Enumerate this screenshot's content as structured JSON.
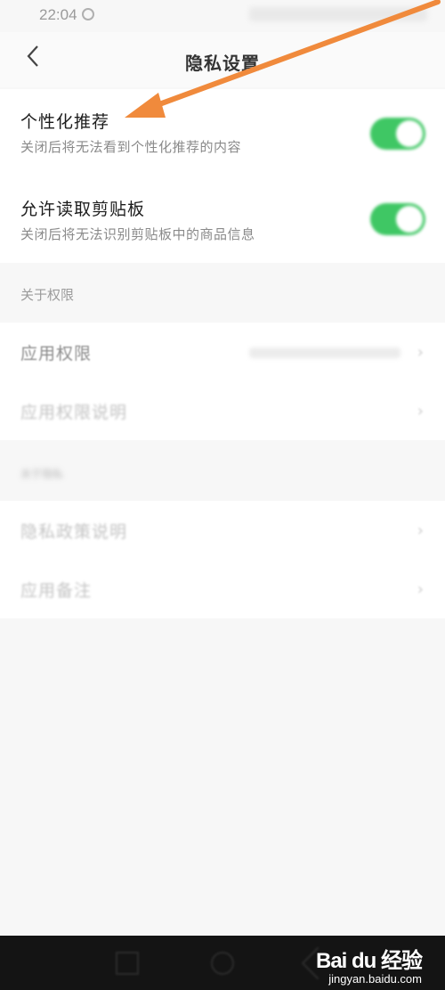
{
  "status": {
    "time": "22:04"
  },
  "header": {
    "title": "隐私设置"
  },
  "settings": [
    {
      "title": "个性化推荐",
      "subtitle": "关闭后将无法看到个性化推荐的内容",
      "enabled": true
    },
    {
      "title": "允许读取剪贴板",
      "subtitle": "关闭后将无法识别剪贴板中的商品信息",
      "enabled": true
    }
  ],
  "permissions": {
    "section_label": "关于权限",
    "items": [
      {
        "label": "应用权限"
      },
      {
        "label": "应用权限说明"
      }
    ]
  },
  "about": {
    "section_label": "关于隐私",
    "items": [
      {
        "label": "隐私政策说明"
      },
      {
        "label": "应用备注"
      }
    ]
  },
  "watermark": {
    "main": "Bai du 经验",
    "sub": "jingyan.baidu.com"
  },
  "colors": {
    "toggle_on": "#3fc764",
    "annotation_arrow": "#f08a3c"
  }
}
